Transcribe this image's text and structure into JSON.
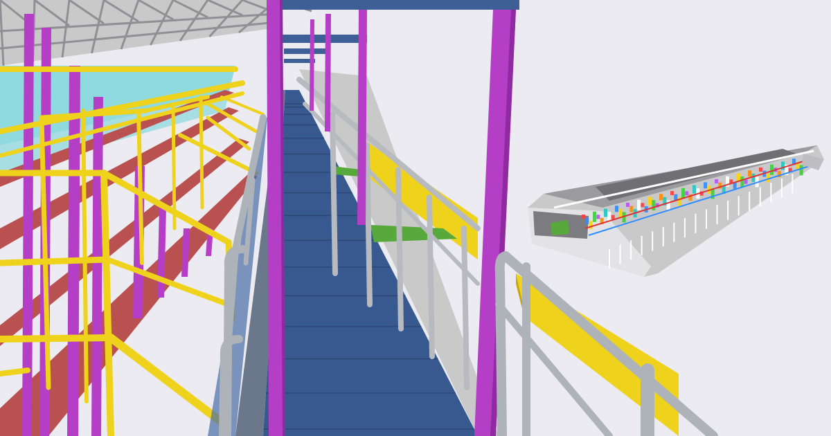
{
  "scene": {
    "kind": "3d-bim-model-render",
    "colors": {
      "background": "#ecebf1",
      "walkway_blue": "#37598f",
      "walkway_blue_light": "#4a6ea6",
      "column_purple": "#b43fc6",
      "column_purple_dark": "#8f2aa0",
      "rail_yellow": "#eed21c",
      "rail_yellow_dark": "#c7a70f",
      "beam_red": "#b85150",
      "handrail_grey": "#aeb3b9",
      "glass_cyan": "#6fd4d8",
      "beam_blue_top": "#3e5f95",
      "green_floor": "#56a93a",
      "structure_grey": "#c9c9c9"
    },
    "inset": {
      "kind": "isometric-building-model-overview"
    }
  }
}
